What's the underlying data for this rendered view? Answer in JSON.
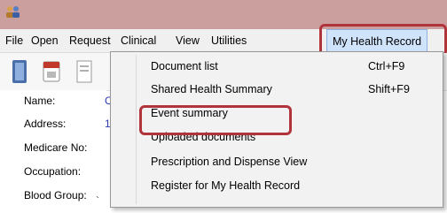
{
  "menubar": {
    "items": [
      "File",
      "Open",
      "Request",
      "Clinical",
      "View",
      "Utilities",
      "My Health Record"
    ]
  },
  "dropdown": {
    "items": [
      {
        "label": "Document list",
        "shortcut": "Ctrl+F9"
      },
      {
        "label": "Shared Health Summary",
        "shortcut": "Shift+F9"
      },
      {
        "label": "Event summary",
        "shortcut": ""
      },
      {
        "label": "Uploaded documents",
        "shortcut": ""
      },
      {
        "label": "Prescription and Dispense View",
        "shortcut": ""
      },
      {
        "label": "Register for My Health Record",
        "shortcut": ""
      }
    ]
  },
  "patient": {
    "labels": [
      "Name:",
      "Address:",
      "Medicare No:",
      "Occupation:",
      "Blood Group:"
    ],
    "name_value_fragment": "C",
    "address_value_fragment": "1"
  },
  "edge_mark": "`",
  "icons": [
    "app-icon",
    "book-icon",
    "calendar-icon",
    "document-icon"
  ],
  "colors": {
    "titlebar": "#cc9f9f",
    "highlight": "#b1343b",
    "active_menu": "#cfe3fb",
    "value_text": "#2b3bb5"
  }
}
